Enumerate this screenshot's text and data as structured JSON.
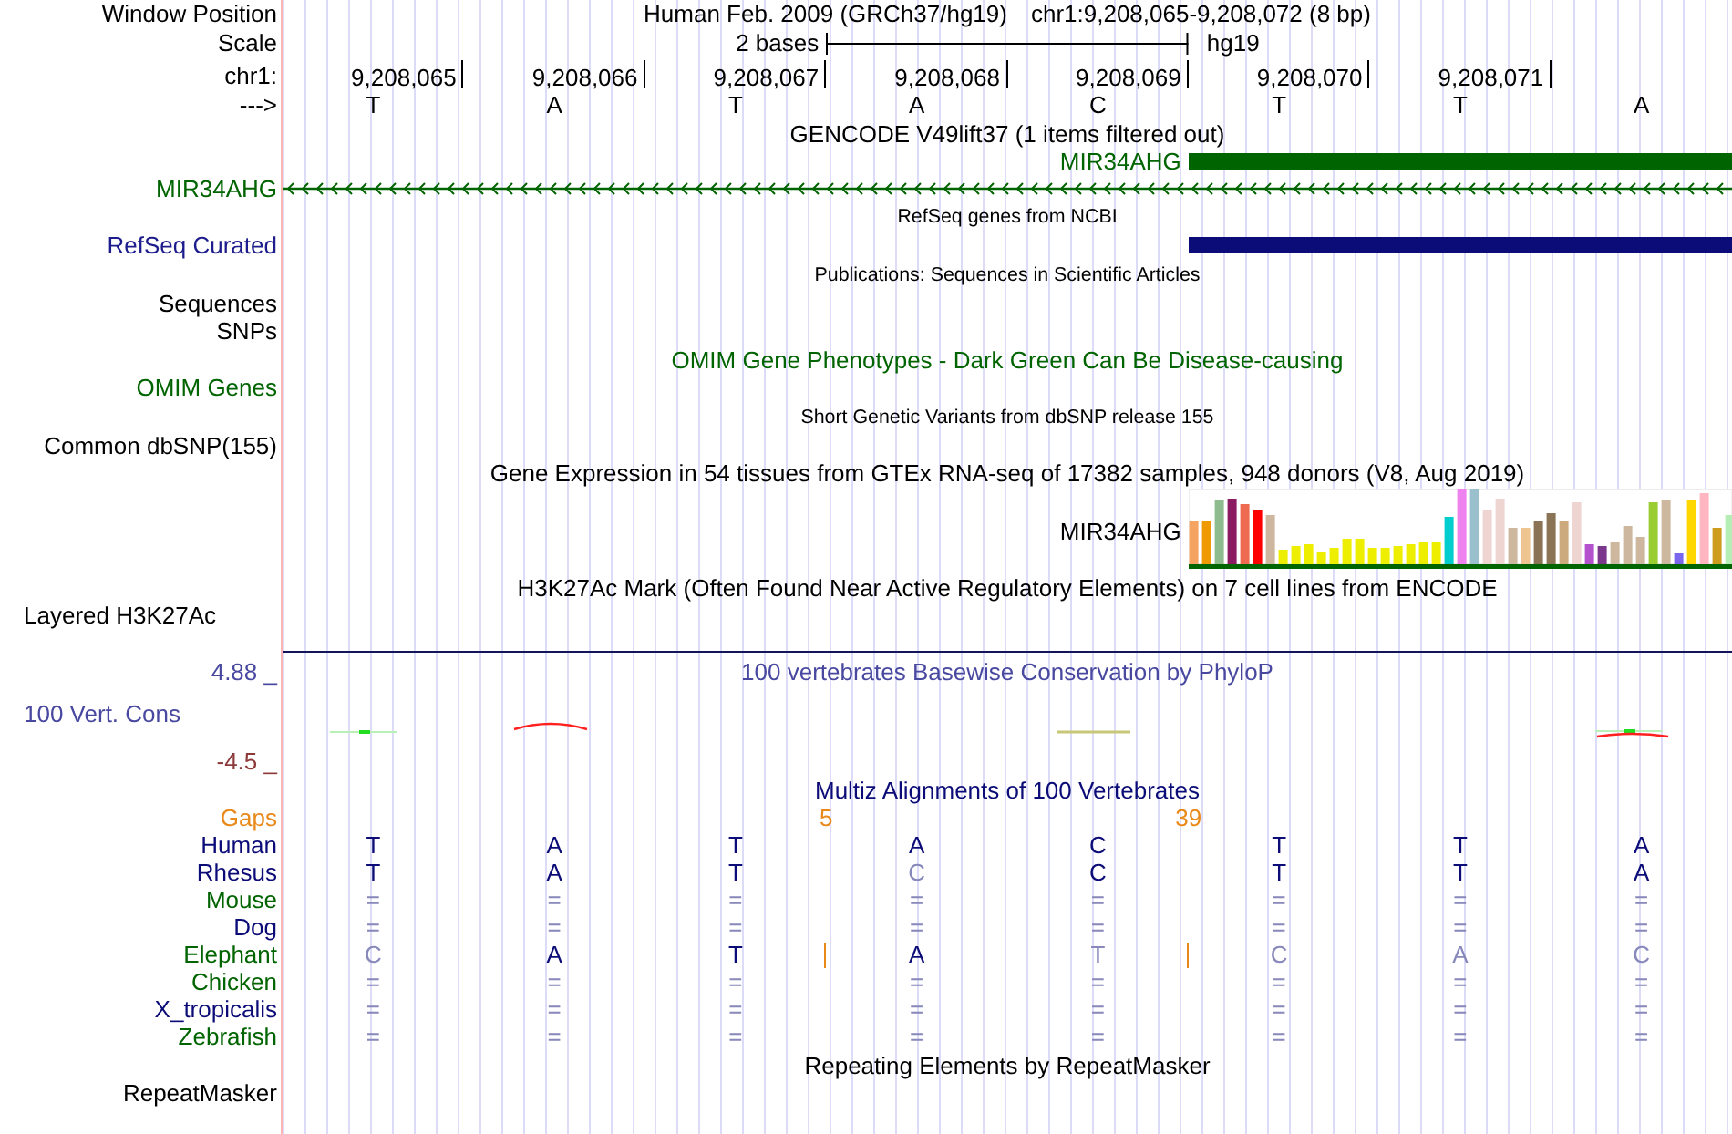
{
  "window_position": {
    "label": "Window Position",
    "assembly": "Human Feb. 2009 (GRCh37/hg19)",
    "region": "chr1:9,208,065-9,208,072 (8 bp)"
  },
  "scale": {
    "label": "Scale",
    "span": "2 bases",
    "assembly": "hg19"
  },
  "ruler": {
    "label": "chr1:",
    "positions": [
      "9,208,065",
      "9,208,066",
      "9,208,067",
      "9,208,068",
      "9,208,069",
      "9,208,070",
      "9,208,071"
    ]
  },
  "sequence": {
    "label": "--->",
    "bases": [
      "T",
      "A",
      "T",
      "A",
      "C",
      "T",
      "T",
      "A"
    ]
  },
  "gencode": {
    "title": "GENCODE V49lift37 (1 items filtered out)",
    "items": [
      {
        "kind": "block",
        "label": "MIR34AHG"
      },
      {
        "kind": "intron",
        "label": "MIR34AHG"
      }
    ]
  },
  "refseq": {
    "title": "RefSeq genes from NCBI",
    "label": "RefSeq Curated"
  },
  "publications": {
    "title": "Publications: Sequences in Scientific Articles",
    "labels": [
      "Sequences",
      "SNPs"
    ]
  },
  "omim": {
    "title": "OMIM Gene Phenotypes - Dark Green Can Be Disease-causing",
    "label": "OMIM Genes"
  },
  "dbsnp": {
    "title": "Short Genetic Variants from dbSNP release 155",
    "label": "Common dbSNP(155)"
  },
  "gtex": {
    "title": "Gene Expression in 54 tissues from GTEx RNA-seq of 17382 samples, 948 donors (V8, Aug 2019)",
    "gene": "MIR34AHG"
  },
  "h3k27ac": {
    "title": "H3K27Ac Mark (Often Found Near Active Regulatory Elements) on 7 cell lines from ENCODE",
    "label": "Layered H3K27Ac"
  },
  "phylop": {
    "title": "100 vertebrates Basewise Conservation by PhyloP",
    "label": "100 Vert. Cons",
    "max": "4.88 _",
    "min": "-4.5 _"
  },
  "multiz": {
    "title": "Multiz Alignments of 100 Vertebrates",
    "gaps": {
      "label": "Gaps",
      "counts": [
        "5",
        "39"
      ]
    },
    "species": [
      {
        "name": "Human",
        "color": "#0c0c78",
        "bases": [
          {
            "base": "T",
            "faded": false
          },
          {
            "base": "A",
            "faded": false
          },
          {
            "base": "T",
            "faded": false
          },
          {
            "base": "A",
            "faded": false
          },
          {
            "base": "C",
            "faded": false
          },
          {
            "base": "T",
            "faded": false
          },
          {
            "base": "T",
            "faded": false
          },
          {
            "base": "A",
            "faded": false
          }
        ]
      },
      {
        "name": "Rhesus",
        "color": "#0c0c78",
        "bases": [
          {
            "base": "T",
            "faded": false
          },
          {
            "base": "A",
            "faded": false
          },
          {
            "base": "T",
            "faded": false
          },
          {
            "base": "C",
            "faded": true
          },
          {
            "base": "C",
            "faded": false
          },
          {
            "base": "T",
            "faded": false
          },
          {
            "base": "T",
            "faded": false
          },
          {
            "base": "A",
            "faded": false
          }
        ]
      },
      {
        "name": "Mouse",
        "color": "#006400",
        "bases": [
          {
            "base": "=",
            "faded": true
          },
          {
            "base": "=",
            "faded": true
          },
          {
            "base": "=",
            "faded": true
          },
          {
            "base": "=",
            "faded": true
          },
          {
            "base": "=",
            "faded": true
          },
          {
            "base": "=",
            "faded": true
          },
          {
            "base": "=",
            "faded": true
          },
          {
            "base": "=",
            "faded": true
          }
        ]
      },
      {
        "name": "Dog",
        "color": "#0c0c78",
        "bases": [
          {
            "base": "=",
            "faded": true
          },
          {
            "base": "=",
            "faded": true
          },
          {
            "base": "=",
            "faded": true
          },
          {
            "base": "=",
            "faded": true
          },
          {
            "base": "=",
            "faded": true
          },
          {
            "base": "=",
            "faded": true
          },
          {
            "base": "=",
            "faded": true
          },
          {
            "base": "=",
            "faded": true
          }
        ]
      },
      {
        "name": "Elephant",
        "color": "#006400",
        "bases": [
          {
            "base": "C",
            "faded": true,
            "insert_after": false
          },
          {
            "base": "A",
            "faded": false,
            "insert_after": false
          },
          {
            "base": "T",
            "faded": false,
            "insert_after": true
          },
          {
            "base": "A",
            "faded": false,
            "insert_after": false
          },
          {
            "base": "T",
            "faded": true,
            "insert_after": true
          },
          {
            "base": "C",
            "faded": true,
            "insert_after": false
          },
          {
            "base": "A",
            "faded": true,
            "insert_after": false
          },
          {
            "base": "C",
            "faded": true,
            "insert_after": false
          }
        ]
      },
      {
        "name": "Chicken",
        "color": "#006400",
        "bases": [
          {
            "base": "=",
            "faded": true
          },
          {
            "base": "=",
            "faded": true
          },
          {
            "base": "=",
            "faded": true
          },
          {
            "base": "=",
            "faded": true
          },
          {
            "base": "=",
            "faded": true
          },
          {
            "base": "=",
            "faded": true
          },
          {
            "base": "=",
            "faded": true
          },
          {
            "base": "=",
            "faded": true
          }
        ]
      },
      {
        "name": "X_tropicalis",
        "color": "#0c0c78",
        "bases": [
          {
            "base": "=",
            "faded": true
          },
          {
            "base": "=",
            "faded": true
          },
          {
            "base": "=",
            "faded": true
          },
          {
            "base": "=",
            "faded": true
          },
          {
            "base": "=",
            "faded": true
          },
          {
            "base": "=",
            "faded": true
          },
          {
            "base": "=",
            "faded": true
          },
          {
            "base": "=",
            "faded": true
          }
        ]
      },
      {
        "name": "Zebrafish",
        "color": "#006400",
        "bases": [
          {
            "base": "=",
            "faded": true
          },
          {
            "base": "=",
            "faded": true
          },
          {
            "base": "=",
            "faded": true
          },
          {
            "base": "=",
            "faded": true
          },
          {
            "base": "=",
            "faded": true
          },
          {
            "base": "=",
            "faded": true
          },
          {
            "base": "=",
            "faded": true
          },
          {
            "base": "=",
            "faded": true
          }
        ]
      }
    ]
  },
  "repeatmasker": {
    "title": "Repeating Elements by RepeatMasker",
    "label": "RepeatMasker"
  }
}
